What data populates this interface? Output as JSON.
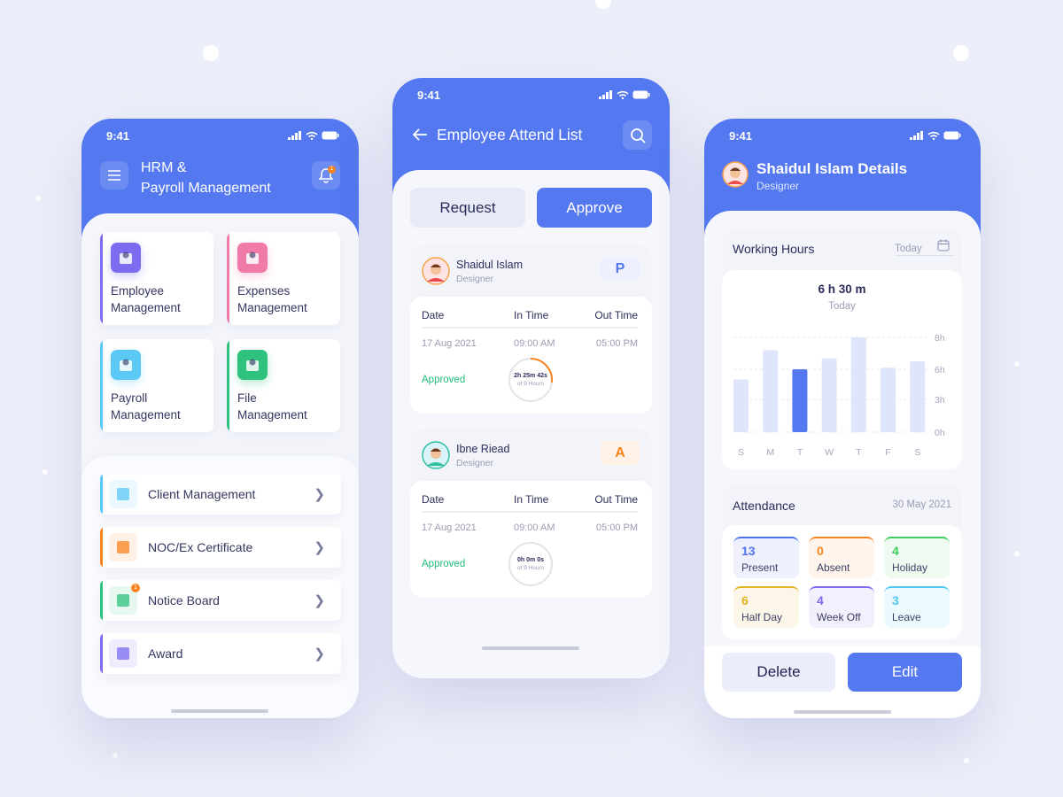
{
  "colors": {
    "primary": "#5478ef",
    "background": "#eceef9",
    "approved": "#1fbf7a",
    "orange": "#f7841e"
  },
  "status_bar": {
    "time": "9:41"
  },
  "hrm_screen": {
    "title_line1": "HRM &",
    "title_line2": "Payroll Management",
    "notification_count": "1",
    "modules": [
      {
        "label_line1": "Employee",
        "label_line2": "Management",
        "color": "#7b6cf0",
        "icon": "employee-icon"
      },
      {
        "label_line1": "Expenses",
        "label_line2": "Management",
        "color": "#f07aa8",
        "icon": "expenses-icon"
      },
      {
        "label_line1": "Payroll",
        "label_line2": "Management",
        "color": "#5cc8f5",
        "icon": "payroll-icon"
      },
      {
        "label_line1": "File",
        "label_line2": "Management",
        "color": "#2ec27e",
        "icon": "file-icon"
      }
    ],
    "menu_items": [
      {
        "label": "Client Management",
        "color": "#5cc8f5",
        "icon": "client-icon"
      },
      {
        "label": "NOC/Ex Certificate",
        "color": "#f7841e",
        "icon": "certificate-icon"
      },
      {
        "label": "Notice Board",
        "color": "#2ec27e",
        "icon": "notice-board-icon",
        "badge": "1"
      },
      {
        "label": "Award",
        "color": "#7b6cf0",
        "icon": "award-icon"
      }
    ]
  },
  "attend_screen": {
    "title": "Employee Attend List",
    "tabs": {
      "request": "Request",
      "approve": "Approve"
    },
    "columns": {
      "date": "Date",
      "in": "In Time",
      "out": "Out Time"
    },
    "employees": [
      {
        "name": "Shaidul Islam",
        "role": "Designer",
        "status_badge": "P",
        "date": "17 Aug 2021",
        "in_time": "09:00 AM",
        "out_time": "05:00 PM",
        "approval": "Approved",
        "elapsed": "2h 25m 42s",
        "of_total": "of 9 Hours",
        "progress": 0.27
      },
      {
        "name": "Ibne Riead",
        "role": "Designer",
        "status_badge": "A",
        "date": "17 Aug 2021",
        "in_time": "09:00 AM",
        "out_time": "05:00 PM",
        "approval": "Approved",
        "elapsed": "0h 0m 0s",
        "of_total": "of 9 Hours",
        "progress": 0
      }
    ]
  },
  "details_screen": {
    "name": "Shaidul Islam Details",
    "role": "Designer",
    "working_hours": {
      "title": "Working Hours",
      "filter": "Today",
      "total": "6 h 30 m",
      "total_label": "Today"
    },
    "attendance": {
      "title": "Attendance",
      "date": "30 May 2021",
      "stats": [
        {
          "value": "13",
          "label": "Present",
          "color": "#4f74ef",
          "bg": "#eef1fd"
        },
        {
          "value": "0",
          "label": "Absent",
          "color": "#f7841e",
          "bg": "#fff5ec"
        },
        {
          "value": "4",
          "label": "Holiday",
          "color": "#3ccd5a",
          "bg": "#effbf1"
        },
        {
          "value": "6",
          "label": "Half Day",
          "color": "#e0b320",
          "bg": "#fbf6e8"
        },
        {
          "value": "4",
          "label": "Week Off",
          "color": "#7b6cf0",
          "bg": "#f2f0fd"
        },
        {
          "value": "3",
          "label": "Leave",
          "color": "#4fc6f0",
          "bg": "#ecf9fd"
        }
      ]
    },
    "buttons": {
      "delete": "Delete",
      "edit": "Edit"
    }
  },
  "chart_data": {
    "type": "bar",
    "categories": [
      "S",
      "M",
      "T",
      "W",
      "T",
      "F",
      "S"
    ],
    "values": [
      5,
      7.2,
      6,
      6.7,
      8,
      6.1,
      6.5
    ],
    "highlight_index": 2,
    "yticks": [
      "0h",
      "3h",
      "6h",
      "8h"
    ],
    "ytick_values": [
      0,
      3,
      6,
      8
    ],
    "ylim": [
      0,
      8
    ],
    "grid": true,
    "colors": {
      "bar": "#dfe6fb",
      "highlight": "#5478ef"
    }
  }
}
